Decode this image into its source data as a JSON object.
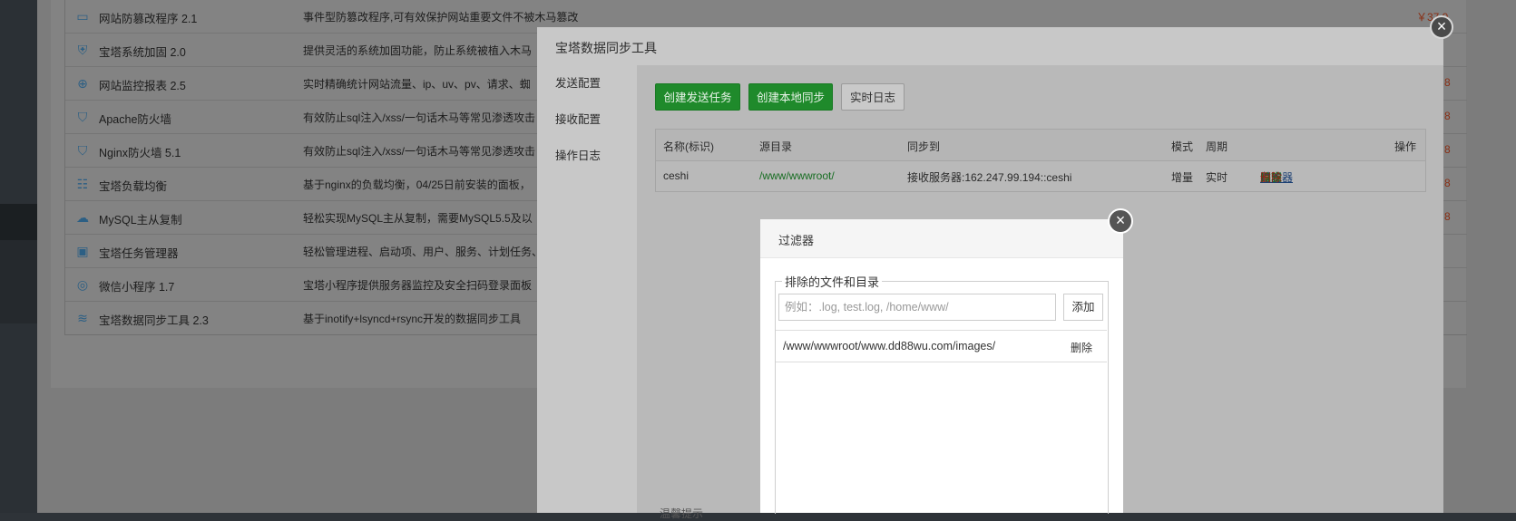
{
  "plugins": [
    {
      "name": "网站防篡改程序 2.1",
      "desc": "事件型防篡改程序,可有效保护网站重要文件不被木马篡改",
      "icon": "shield-lock-icon"
    },
    {
      "name": "宝塔系统加固 2.0",
      "desc": "提供灵活的系统加固功能，防止系统被植入木马",
      "icon": "shield-plus-icon"
    },
    {
      "name": "网站监控报表 2.5",
      "desc": "实时精确统计网站流量、ip、uv、pv、请求、蜘",
      "icon": "globe-icon"
    },
    {
      "name": "Apache防火墙",
      "desc": "有效防止sql注入/xss/一句话木马等常见渗透攻击",
      "icon": "waf-icon"
    },
    {
      "name": "Nginx防火墙 5.1",
      "desc": "有效防止sql注入/xss/一句话木马等常见渗透攻击",
      "icon": "waf-icon"
    },
    {
      "name": "宝塔负载均衡",
      "desc": "基于nginx的负载均衡，04/25日前安装的面板，",
      "icon": "network-tree-icon"
    },
    {
      "name": "MySQL主从复制",
      "desc": "轻松实现MySQL主从复制，需要MySQL5.5及以",
      "icon": "cloud-sync-icon"
    },
    {
      "name": "宝塔任务管理器",
      "desc": "轻松管理进程、启动项、用户、服务、计划任务、",
      "icon": "monitor-icon"
    },
    {
      "name": "微信小程序 1.7",
      "desc": "宝塔小程序提供服务器监控及安全扫码登录面板",
      "icon": "wechat-mini-icon"
    },
    {
      "name": "宝塔数据同步工具 2.3",
      "desc": "基于inotify+lsyncd+rsync开发的数据同步工具",
      "icon": "database-sync-icon"
    }
  ],
  "prices": [
    "￥37.9",
    "8",
    "8",
    "8",
    "8",
    "8"
  ],
  "sync_dialog": {
    "title": "宝塔数据同步工具",
    "nav": [
      "发送配置",
      "接收配置",
      "操作日志"
    ],
    "buttons": {
      "create_send": "创建发送任务",
      "create_local": "创建本地同步",
      "realtime_log": "实时日志"
    },
    "table": {
      "headers": {
        "name": "名称(标识)",
        "src": "源目录",
        "dest": "同步到",
        "mode": "模式",
        "period": "周期",
        "ops": "操作"
      },
      "row": {
        "name": "ceshi",
        "src": "/www/wwwroot/",
        "dest": "接收服务器:162.247.99.194::ceshi",
        "mode": "增量",
        "period": "实时"
      },
      "ops": {
        "sync": "同步",
        "log": "日志",
        "filter": "过滤器",
        "edit": "编辑",
        "delete": "删除"
      },
      "sep": "|"
    },
    "cutoff_text": "温馨提示"
  },
  "filter_dialog": {
    "title": "过滤器",
    "legend": "排除的文件和目录",
    "input_placeholder": "例如：.log, test.log, /home/www/",
    "add_label": "添加",
    "items": [
      {
        "path": "/www/wwwroot/www.dd88wu.com/images/",
        "delete_label": "删除"
      }
    ]
  },
  "close_glyph": "×"
}
